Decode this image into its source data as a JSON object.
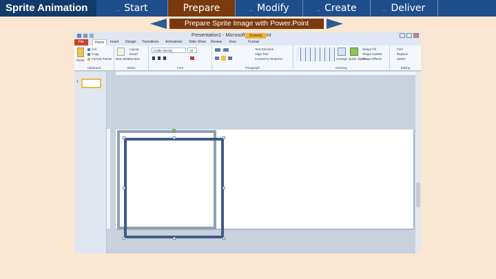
{
  "nav": {
    "brand": "Sprite Animation",
    "tabs": [
      {
        "label": "Start",
        "active": false
      },
      {
        "label": "Prepare",
        "active": true
      },
      {
        "label": "Modify",
        "active": false
      },
      {
        "label": "Create",
        "active": false
      },
      {
        "label": "Deliver",
        "active": false
      }
    ],
    "dots": ".."
  },
  "subtitle": "Prepare Sprite Image with Power.Point",
  "ppt": {
    "title": "Presentation1 - Microsoft PowerPoint",
    "context_tab": "Drawing Tools",
    "ribbon_tabs": [
      "File",
      "Home",
      "Insert",
      "Design",
      "Transitions",
      "Animations",
      "Slide Show",
      "Review",
      "View",
      "Format"
    ],
    "groups": [
      "Clipboard",
      "Slides",
      "Font",
      "Paragraph",
      "Drawing",
      "Editing"
    ],
    "clipboard": {
      "paste": "Paste",
      "cut": "Cut",
      "copy": "Copy",
      "painter": "Format Painter"
    },
    "slides": {
      "new": "New Slide",
      "layout": "Layout",
      "reset": "Reset",
      "section": "Section"
    },
    "font": {
      "name": "Calibri (Body)",
      "size": "18"
    },
    "paragraph": {
      "direction": "Text Direction",
      "align": "Align Text",
      "smartart": "Convert to SmartArt"
    },
    "drawing": {
      "arrange": "Arrange",
      "quick": "Quick Styles",
      "fill": "Shape Fill",
      "outline": "Shape Outline",
      "effects": "Shape Effects"
    },
    "editing": {
      "find": "Find",
      "replace": "Replace",
      "select": "Select"
    },
    "slide_number": "1"
  },
  "colors": {
    "background": "#fbe7d1",
    "nav": "#1f4f8a",
    "brand": "#123a6b",
    "active": "#7a3a0f",
    "back_square": "#8da1b8",
    "front_square": "#3c5b8a"
  }
}
